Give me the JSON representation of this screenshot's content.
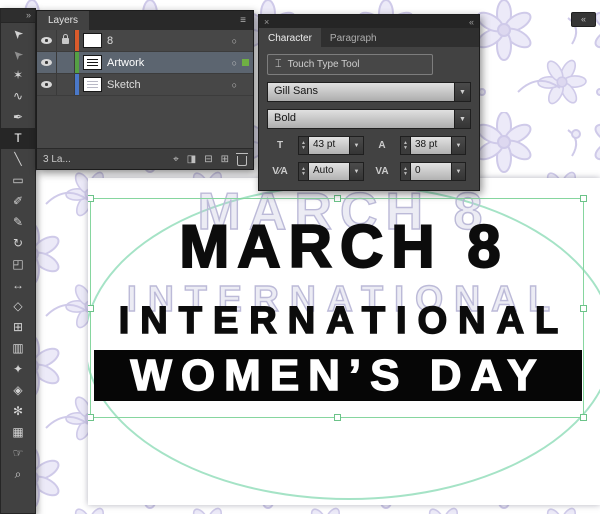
{
  "window": {
    "dock_collapse_glyph": "«"
  },
  "toolbar": {
    "collapse_glyph": "»",
    "tools": [
      {
        "name": "selection",
        "glyph": "➤"
      },
      {
        "name": "direct-selection",
        "glyph": "➤"
      },
      {
        "name": "magic-wand",
        "glyph": "✶"
      },
      {
        "name": "lasso",
        "glyph": "∿"
      },
      {
        "name": "pen",
        "glyph": "✒"
      },
      {
        "name": "type",
        "glyph": "T"
      },
      {
        "name": "line-segment",
        "glyph": "╲"
      },
      {
        "name": "rectangle",
        "glyph": "▭"
      },
      {
        "name": "paintbrush",
        "glyph": "✐"
      },
      {
        "name": "pencil",
        "glyph": "✎"
      },
      {
        "name": "rotate",
        "glyph": "↻"
      },
      {
        "name": "scale",
        "glyph": "◰"
      },
      {
        "name": "width",
        "glyph": "↔"
      },
      {
        "name": "shape-builder",
        "glyph": "◇"
      },
      {
        "name": "mesh",
        "glyph": "⊞"
      },
      {
        "name": "gradient",
        "glyph": "▥"
      },
      {
        "name": "eyedropper",
        "glyph": "✦"
      },
      {
        "name": "blend",
        "glyph": "◈"
      },
      {
        "name": "symbol-sprayer",
        "glyph": "✻"
      },
      {
        "name": "column-graph",
        "glyph": "▦"
      },
      {
        "name": "hand",
        "glyph": "☞"
      },
      {
        "name": "zoom",
        "glyph": "⌕"
      }
    ]
  },
  "layers_panel": {
    "tab": "Layers",
    "menu_glyph": "≡",
    "target_glyph": "○",
    "rows": [
      {
        "name": "8",
        "color": "#d95b2b",
        "locked": true,
        "selected": false
      },
      {
        "name": "Artwork",
        "color": "#55a044",
        "locked": false,
        "selected": true
      },
      {
        "name": "Sketch",
        "color": "#4a78c8",
        "locked": false,
        "selected": false
      }
    ],
    "status": "3 La...",
    "icons": {
      "locate": "⌖",
      "clip_mask": "◨",
      "new_sublayer": "⊟",
      "new_layer": "⊞"
    }
  },
  "character_panel": {
    "close_glyph": "×",
    "collapse_glyph": "«",
    "tabs": [
      {
        "label": "Character",
        "active": true
      },
      {
        "label": "Paragraph",
        "active": false
      }
    ],
    "touch_type": {
      "icon_glyph": "⌶",
      "label": "Touch Type Tool"
    },
    "font_family": "Gill Sans",
    "font_style": "Bold",
    "font_size_icon": "T",
    "font_size": "43 pt",
    "leading_icon": "A",
    "leading": "38 pt",
    "kerning_icon": "V∕A",
    "kerning": "Auto",
    "tracking_icon": "VA",
    "tracking": "0",
    "caret_glyph": "▼",
    "stepper_up": "▲",
    "stepper_down": "▼"
  },
  "canvas": {
    "ghost_line1": "MARCH 8",
    "ghost_line2": "INTERNATIONAL",
    "line1": "MARCH 8",
    "line2": "INTERNATIONAL",
    "line3": "WOMEN’S DAY"
  },
  "colors": {
    "selection_green": "#86d69f",
    "ellipse_stroke": "#a5e3c6",
    "selected_row_bg": "#5c6570",
    "pattern_lavender": "#cfcae9"
  }
}
